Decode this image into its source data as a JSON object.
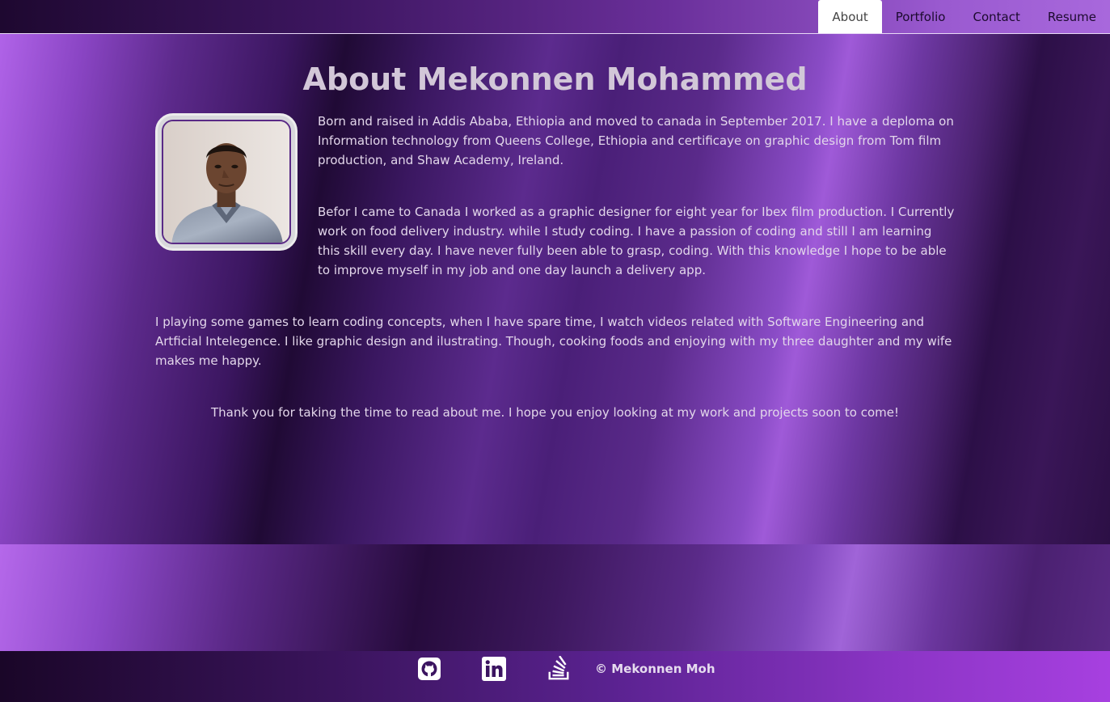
{
  "nav": {
    "items": [
      {
        "label": "About",
        "active": true
      },
      {
        "label": "Portfolio",
        "active": false
      },
      {
        "label": "Contact",
        "active": false
      },
      {
        "label": "Resume",
        "active": false
      }
    ]
  },
  "main": {
    "title": "About Mekonnen Mohammed",
    "portrait_alt": "portrait photo",
    "paragraphs": [
      "Born and raised in Addis Ababa, Ethiopia and moved to canada in September 2017. I have a deploma on Information technology from Queens College, Ethiopia and certificaye on graphic design from Tom film production, and Shaw Academy, Ireland.",
      "Befor I came to Canada I worked as a graphic designer for eight year for Ibex film production. I Currently work on food delivery industry. while I study coding. I have a passion of coding and still I am learning this skill every day. I have never fully been able to grasp, coding. With this knowledge I hope to be able to improve myself in my job and one day launch a delivery app.",
      "I playing some games to learn coding concepts, when I have spare time, I watch videos related with Software Engineering and Artficial Intelegence. I like graphic design and ilustrating. Though, cooking foods and enjoying with my three daughter and my wife makes me happy.",
      "Thank you for taking the time to read about me. I hope you enjoy looking at my work and projects soon to come!"
    ]
  },
  "footer": {
    "icons": [
      "github-icon",
      "linkedin-icon",
      "stackoverflow-icon"
    ],
    "copyright": "© Mekonnen Moh"
  },
  "colors": {
    "accent": "#8a45c4",
    "text": "#e2d6ea",
    "title": "#d2c7d8",
    "active_tab_bg": "#ffffff"
  }
}
